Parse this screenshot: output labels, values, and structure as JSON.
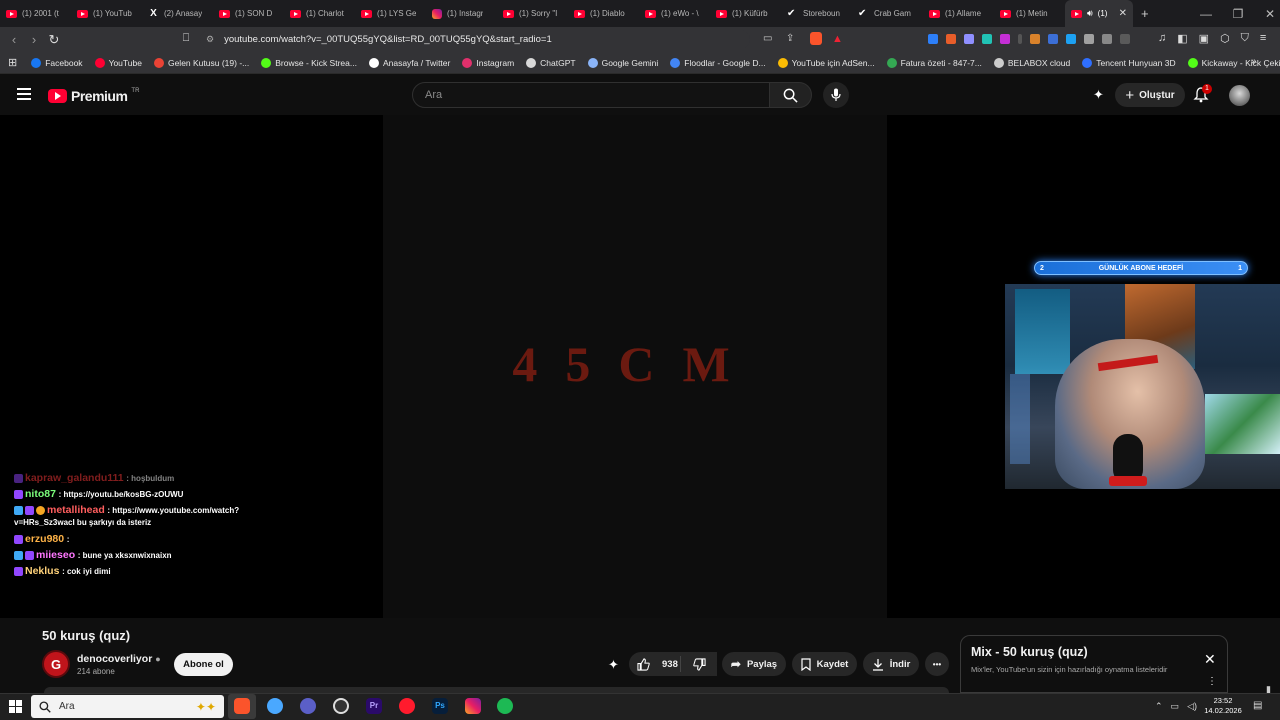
{
  "browser": {
    "tabs": [
      {
        "label": "(1) 2001 (t",
        "icon": "youtube-icon"
      },
      {
        "label": "(1) YouTub",
        "icon": "youtube-icon"
      },
      {
        "label": "(2) Anasay",
        "icon": "x-icon"
      },
      {
        "label": "(1) SON D",
        "icon": "youtube-icon"
      },
      {
        "label": "(1) Charlot",
        "icon": "youtube-icon"
      },
      {
        "label": "(1) LYS Ge",
        "icon": "youtube-icon"
      },
      {
        "label": "(1) Instagr",
        "icon": "instagram-icon"
      },
      {
        "label": "(1) Sorry \"I",
        "icon": "youtube-icon"
      },
      {
        "label": "(1) Diablo",
        "icon": "youtube-icon"
      },
      {
        "label": "(1) eWo - \\",
        "icon": "youtube-icon"
      },
      {
        "label": "(1) Küfürb",
        "icon": "youtube-icon"
      },
      {
        "label": "Storeboun",
        "icon": "steam-icon"
      },
      {
        "label": "Crab Gam",
        "icon": "steam-icon"
      },
      {
        "label": "(1) Allame",
        "icon": "youtube-icon"
      },
      {
        "label": "(1) Metin",
        "icon": "youtube-icon"
      }
    ],
    "active_tab": {
      "label": "(1)",
      "close": "✕"
    },
    "new_tab": "+",
    "url": "youtube.com/watch?v=_00TUQ55gYQ&list=RD_00TUQ55gYQ&start_radio=1",
    "bookmarks": [
      {
        "label": "Facebook",
        "color": "#1877f2"
      },
      {
        "label": "YouTube",
        "color": "#ff0033"
      },
      {
        "label": "Gelen Kutusu (19) -...",
        "color": "#ea4335"
      },
      {
        "label": "Browse - Kick Strea...",
        "color": "#53fc18"
      },
      {
        "label": "Anasayfa / Twitter",
        "color": "#ffffff"
      },
      {
        "label": "Instagram",
        "color": "#e1306c"
      },
      {
        "label": "ChatGPT",
        "color": "#d9d9d9"
      },
      {
        "label": "Google Gemini",
        "color": "#8ab4f8"
      },
      {
        "label": "Floodlar - Google D...",
        "color": "#4285f4"
      },
      {
        "label": "YouTube için AdSen...",
        "color": "#fbbc04"
      },
      {
        "label": "Fatura özeti - 847-7...",
        "color": "#34a853"
      },
      {
        "label": "BELABOX cloud",
        "color": "#cccccc"
      },
      {
        "label": "Tencent Hunyuan 3D",
        "color": "#2f6fff"
      },
      {
        "label": "Kickaway - Kick Çeki...",
        "color": "#53fc18"
      }
    ]
  },
  "youtube": {
    "logo_text": "Premium",
    "logo_region": "TR",
    "search_placeholder": "Ara",
    "create_label": "Oluştur",
    "notification_count": "1"
  },
  "video": {
    "overlay_title": "45CM",
    "sub_goal": {
      "label": "GÜNLÜK ABONE HEDEFİ",
      "left": "2",
      "right": "1"
    },
    "chat": [
      {
        "user": "kapraw_galandu111",
        "msg": ": hoşbuldum",
        "color": "#ff3b3b"
      },
      {
        "user": "nito87",
        "msg": ": https://youtu.be/kosBG-zOUWU",
        "color": "#7cff7c"
      },
      {
        "user": "metallihead",
        "msg": ": https://www.youtube.com/watch?v=HRs_Sz3wacI bu şarkıyı da isteriz",
        "color": "#ff5e5e"
      },
      {
        "user": "erzu980",
        "msg": ":",
        "color": "#ffb347"
      },
      {
        "user": "miieseo",
        "msg": ": bune ya xksxnwixnaixn",
        "color": "#ff77ff"
      },
      {
        "user": "Neklus",
        "msg": ": cok iyi dimi",
        "color": "#ffd27a"
      }
    ]
  },
  "watch": {
    "title": "50 kuruş (quz)",
    "channel": "denocoverliyor",
    "subscribers": "214 abone",
    "subscribe_label": "Abone ol",
    "likes": "938",
    "share_label": "Paylaş",
    "save_label": "Kaydet",
    "download_label": "İndir",
    "more_label": "•••"
  },
  "mix": {
    "title": "Mix - 50 kuruş (quz)",
    "subtitle": "Mix'ler, YouTube'un sizin için hazırladığı oynatma listeleridir",
    "close": "✕"
  },
  "taskbar": {
    "search_placeholder": "Ara",
    "time": "23:52",
    "date": "14.02.2026"
  }
}
